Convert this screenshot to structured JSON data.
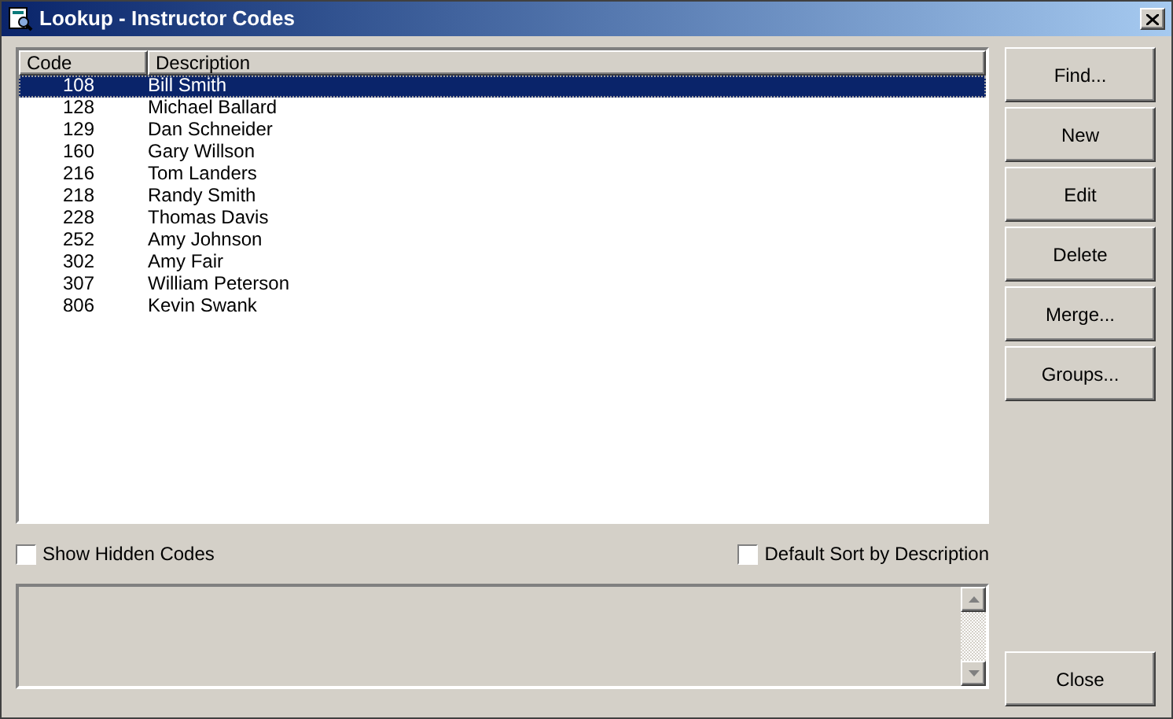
{
  "window": {
    "title": "Lookup - Instructor Codes"
  },
  "table": {
    "columns": [
      "Code",
      "Description"
    ],
    "rows": [
      {
        "code": "108",
        "description": "Bill Smith",
        "selected": true
      },
      {
        "code": "128",
        "description": "Michael Ballard",
        "selected": false
      },
      {
        "code": "129",
        "description": "Dan Schneider",
        "selected": false
      },
      {
        "code": "160",
        "description": "Gary Willson",
        "selected": false
      },
      {
        "code": "216",
        "description": "Tom Landers",
        "selected": false
      },
      {
        "code": "218",
        "description": "Randy Smith",
        "selected": false
      },
      {
        "code": "228",
        "description": "Thomas Davis",
        "selected": false
      },
      {
        "code": "252",
        "description": "Amy Johnson",
        "selected": false
      },
      {
        "code": "302",
        "description": "Amy Fair",
        "selected": false
      },
      {
        "code": "307",
        "description": "William Peterson",
        "selected": false
      },
      {
        "code": "806",
        "description": "Kevin Swank",
        "selected": false
      }
    ]
  },
  "buttons": [
    "Find...",
    "New",
    "Edit",
    "Delete",
    "Merge...",
    "Groups..."
  ],
  "checkboxes": [
    {
      "label": "Show Hidden Codes",
      "checked": false
    },
    {
      "label": "Default Sort by Description",
      "checked": false
    }
  ],
  "close_button": "Close"
}
